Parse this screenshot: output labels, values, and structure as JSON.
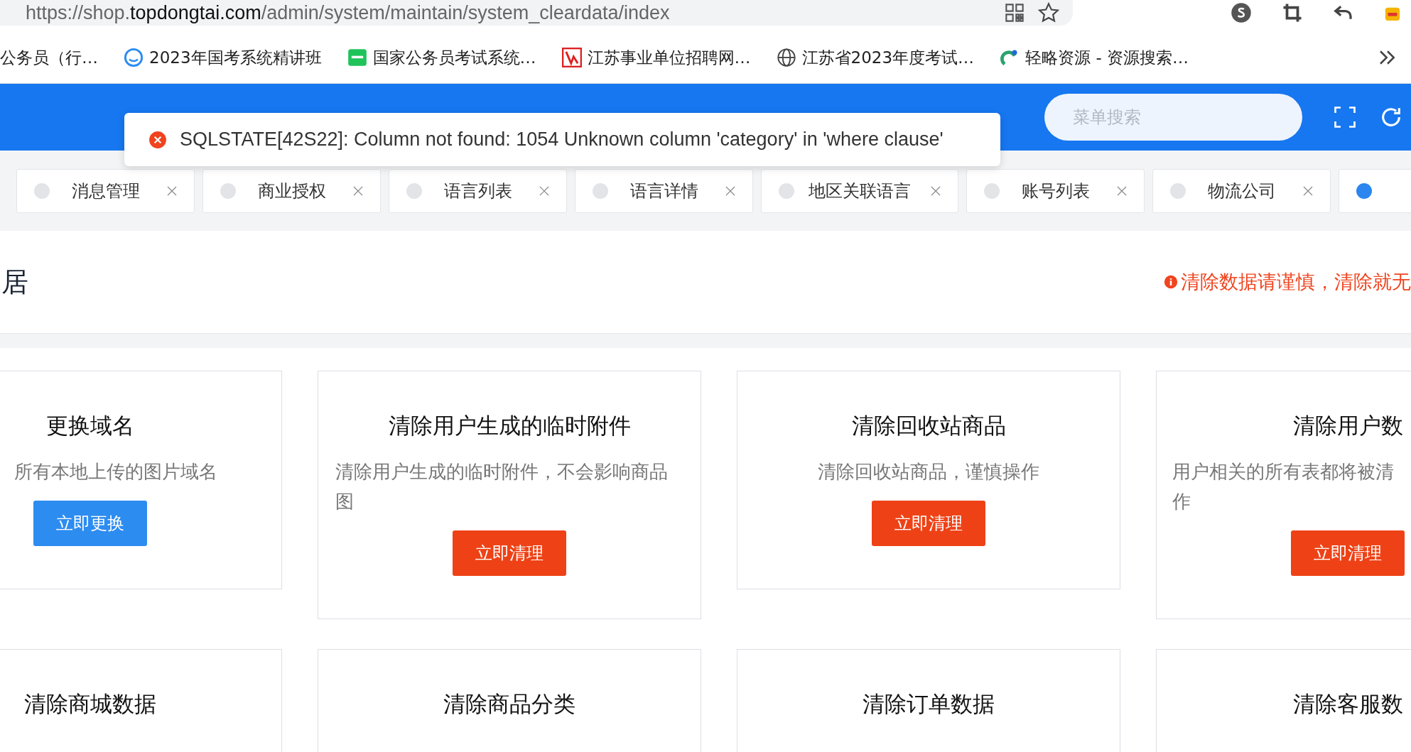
{
  "browser": {
    "url": {
      "scheme": "https://shop.",
      "host": "topdongtai.com",
      "path": "/admin/system/maintain/system_cleardata/index"
    },
    "bookmarks": [
      {
        "label": "公务员（行…"
      },
      {
        "label": "2023年国考系统精讲班"
      },
      {
        "label": "国家公务员考试系统…"
      },
      {
        "label": "江苏事业单位招聘网…"
      },
      {
        "label": "江苏省2023年度考试…"
      },
      {
        "label": "轻略资源 - 资源搜索…"
      }
    ]
  },
  "header": {
    "search": {
      "placeholder": "菜单搜索"
    }
  },
  "toast": {
    "message": "SQLSTATE[42S22]: Column not found: 1054 Unknown column 'category' in 'where clause'"
  },
  "tabs": [
    {
      "label": "消息管理",
      "selected": false
    },
    {
      "label": "商业授权",
      "selected": false
    },
    {
      "label": "语言列表",
      "selected": false
    },
    {
      "label": "语言详情",
      "selected": false
    },
    {
      "label": "地区关联语言",
      "selected": false
    },
    {
      "label": "账号列表",
      "selected": false
    },
    {
      "label": "物流公司",
      "selected": false
    },
    {
      "selected": true
    }
  ],
  "page": {
    "title": "居",
    "warning": "清除数据请谨慎，清除就无"
  },
  "cards": [
    {
      "title": "更换域名",
      "description": "所有本地上传的图片域名",
      "button": "立即更换",
      "kind": "primary"
    },
    {
      "title": "清除用户生成的临时附件",
      "description": "清除用户生成的临时附件，不会影响商品图",
      "button": "立即清理",
      "kind": "danger"
    },
    {
      "title": "清除回收站商品",
      "description": "清除回收站商品，谨慎操作",
      "button": "立即清理",
      "kind": "danger"
    },
    {
      "title": "清除用户数",
      "description": "用户相关的所有表都将被清作",
      "button": "立即清理",
      "kind": "danger"
    },
    {
      "title": "清除商城数据"
    },
    {
      "title": "清除商品分类"
    },
    {
      "title": "清除订单数据"
    },
    {
      "title": "清除客服数"
    }
  ]
}
